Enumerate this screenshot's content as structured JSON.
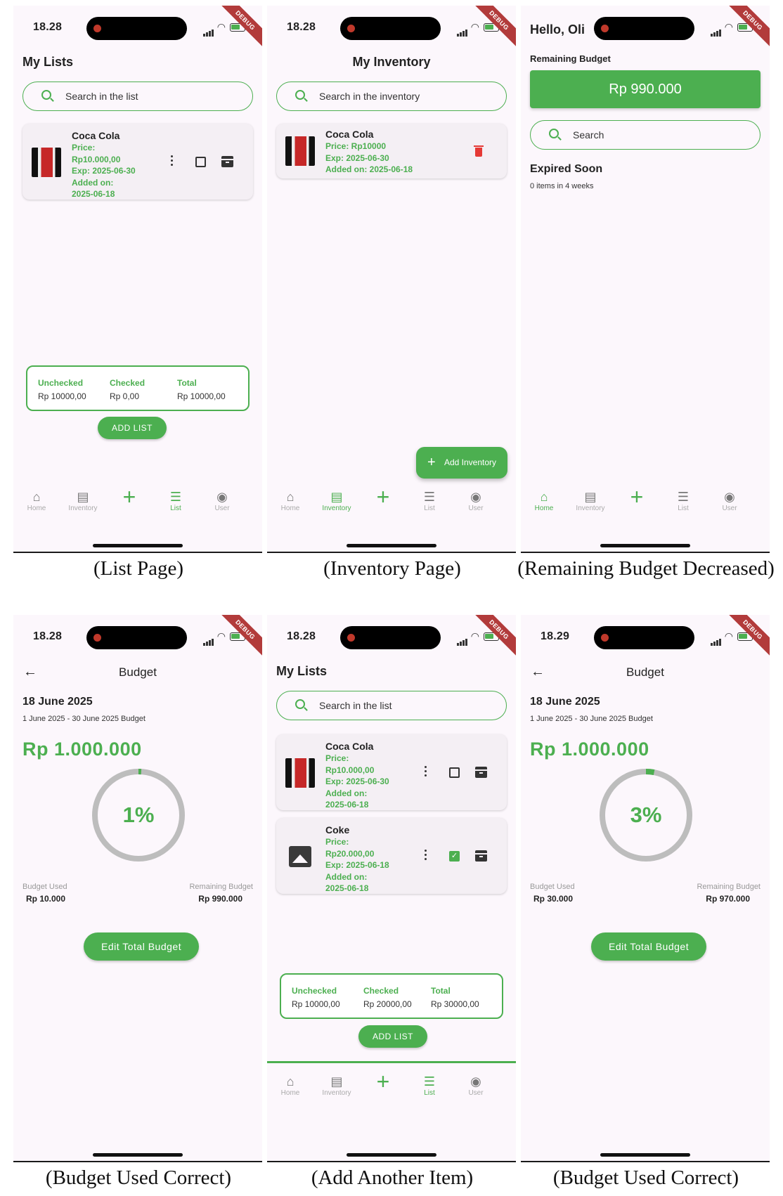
{
  "status": {
    "time_a": "18.28",
    "time_b": "18.29",
    "debug": "DEBUG"
  },
  "nav": {
    "home": "Home",
    "inventory": "Inventory",
    "list": "List",
    "user": "User"
  },
  "colors": {
    "accent": "#4caf50",
    "danger": "#e53935"
  },
  "list_page": {
    "title": "My Lists",
    "search_placeholder": "Search in the list",
    "item": {
      "name": "Coca Cola",
      "price_label": "Price:",
      "price": "Rp10.000,00",
      "exp": "Exp: 2025-06-30",
      "added_label": "Added on:",
      "added": "2025-06-18"
    },
    "summary": {
      "unchecked_label": "Unchecked",
      "unchecked": "Rp 10000,00",
      "checked_label": "Checked",
      "checked": "Rp 0,00",
      "total_label": "Total",
      "total": "Rp 10000,00"
    },
    "add_button": "ADD LIST",
    "caption": "(List Page)"
  },
  "inventory_page": {
    "title": "My Inventory",
    "search_placeholder": "Search in the inventory",
    "item": {
      "name": "Coca Cola",
      "price": "Price: Rp10000",
      "exp": "Exp: 2025-06-30",
      "added": "Added on: 2025-06-18"
    },
    "fab": "Add Inventory",
    "caption": "(Inventory Page)"
  },
  "home_page": {
    "greeting": "Hello, Oli",
    "remaining_label": "Remaining Budget",
    "remaining": "Rp 990.000",
    "search_placeholder": "Search",
    "expired_title": "Expired Soon",
    "expired_sub": "0 items in 4 weeks",
    "caption": "(Remaining Budget Decreased)"
  },
  "budget_a": {
    "title": "Budget",
    "date": "18 June 2025",
    "range": "1 June 2025 - 30 June 2025 Budget",
    "amount": "Rp 1.000.000",
    "percent": "1%",
    "used_fraction": 0.01,
    "used_label": "Budget Used",
    "used": "Rp 10.000",
    "remaining_label": "Remaining Budget",
    "remaining": "Rp 990.000",
    "edit_button": "Edit Total Budget",
    "caption": "(Budget Used Correct)"
  },
  "list_page_2": {
    "title": "My Lists",
    "search_placeholder": "Search in the list",
    "item1": {
      "name": "Coca Cola",
      "price_label": "Price:",
      "price": "Rp10.000,00",
      "exp": "Exp: 2025-06-30",
      "added_label": "Added on:",
      "added": "2025-06-18"
    },
    "item2": {
      "name": "Coke",
      "price_label": "Price:",
      "price": "Rp20.000,00",
      "exp": "Exp: 2025-06-18",
      "added_label": "Added on:",
      "added": "2025-06-18"
    },
    "summary": {
      "unchecked_label": "Unchecked",
      "unchecked": "Rp 10000,00",
      "checked_label": "Checked",
      "checked": "Rp 20000,00",
      "total_label": "Total",
      "total": "Rp 30000,00"
    },
    "add_button": "ADD LIST",
    "caption": "(Add Another Item)"
  },
  "budget_b": {
    "title": "Budget",
    "date": "18 June 2025",
    "range": "1 June 2025 - 30 June 2025 Budget",
    "amount": "Rp 1.000.000",
    "percent": "3%",
    "used_fraction": 0.03,
    "used_label": "Budget Used",
    "used": "Rp 30.000",
    "remaining_label": "Remaining Budget",
    "remaining": "Rp 970.000",
    "edit_button": "Edit Total Budget",
    "caption": "(Budget Used Correct)"
  }
}
